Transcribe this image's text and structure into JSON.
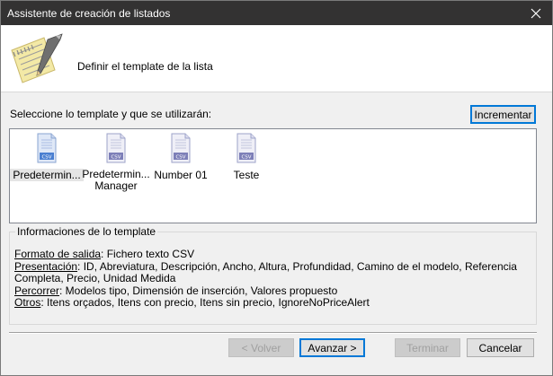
{
  "window": {
    "title": "Assistente de creación de listados"
  },
  "header": {
    "title": "Definir el template de la lista",
    "icon": "notepad-pen-icon"
  },
  "main": {
    "prompt": "Seleccione lo template y que se utilizarán:",
    "increment_label": "Incrementar",
    "templates": [
      {
        "label": "Predetermin...",
        "icon": "csv-file-icon",
        "selected": true
      },
      {
        "label": "Predetermin... Manager",
        "icon": "csv-file-icon",
        "selected": false
      },
      {
        "label": "Number 01",
        "icon": "csv-file-icon",
        "selected": false
      },
      {
        "label": "Teste",
        "icon": "csv-file-icon",
        "selected": false
      }
    ]
  },
  "info": {
    "legend": "Informaciones de lo template",
    "output_key": "Formato de salida",
    "output_val": ": Fichero texto CSV",
    "presentation_key": "Presentación",
    "presentation_val": ": ID, Abreviatura, Descripción, Ancho, Altura, Profundidad, Camino de el modelo, Referencia Completa, Precio, Unidad Medida",
    "traverse_key": "Percorrer",
    "traverse_val": ": Modelos tipo, Dimensión de  inserción, Valores propuesto",
    "others_key": "Otros",
    "others_val": ": Itens orçados, Itens con precio, Itens sin precio, IgnoreNoPriceAlert"
  },
  "footer": {
    "back": "< Volver",
    "next": "Avanzar >",
    "finish": "Terminar",
    "cancel": "Cancelar"
  },
  "colors": {
    "titlebar": "#333232",
    "accent": "#0078d7",
    "panel": "#f0f0f0"
  }
}
